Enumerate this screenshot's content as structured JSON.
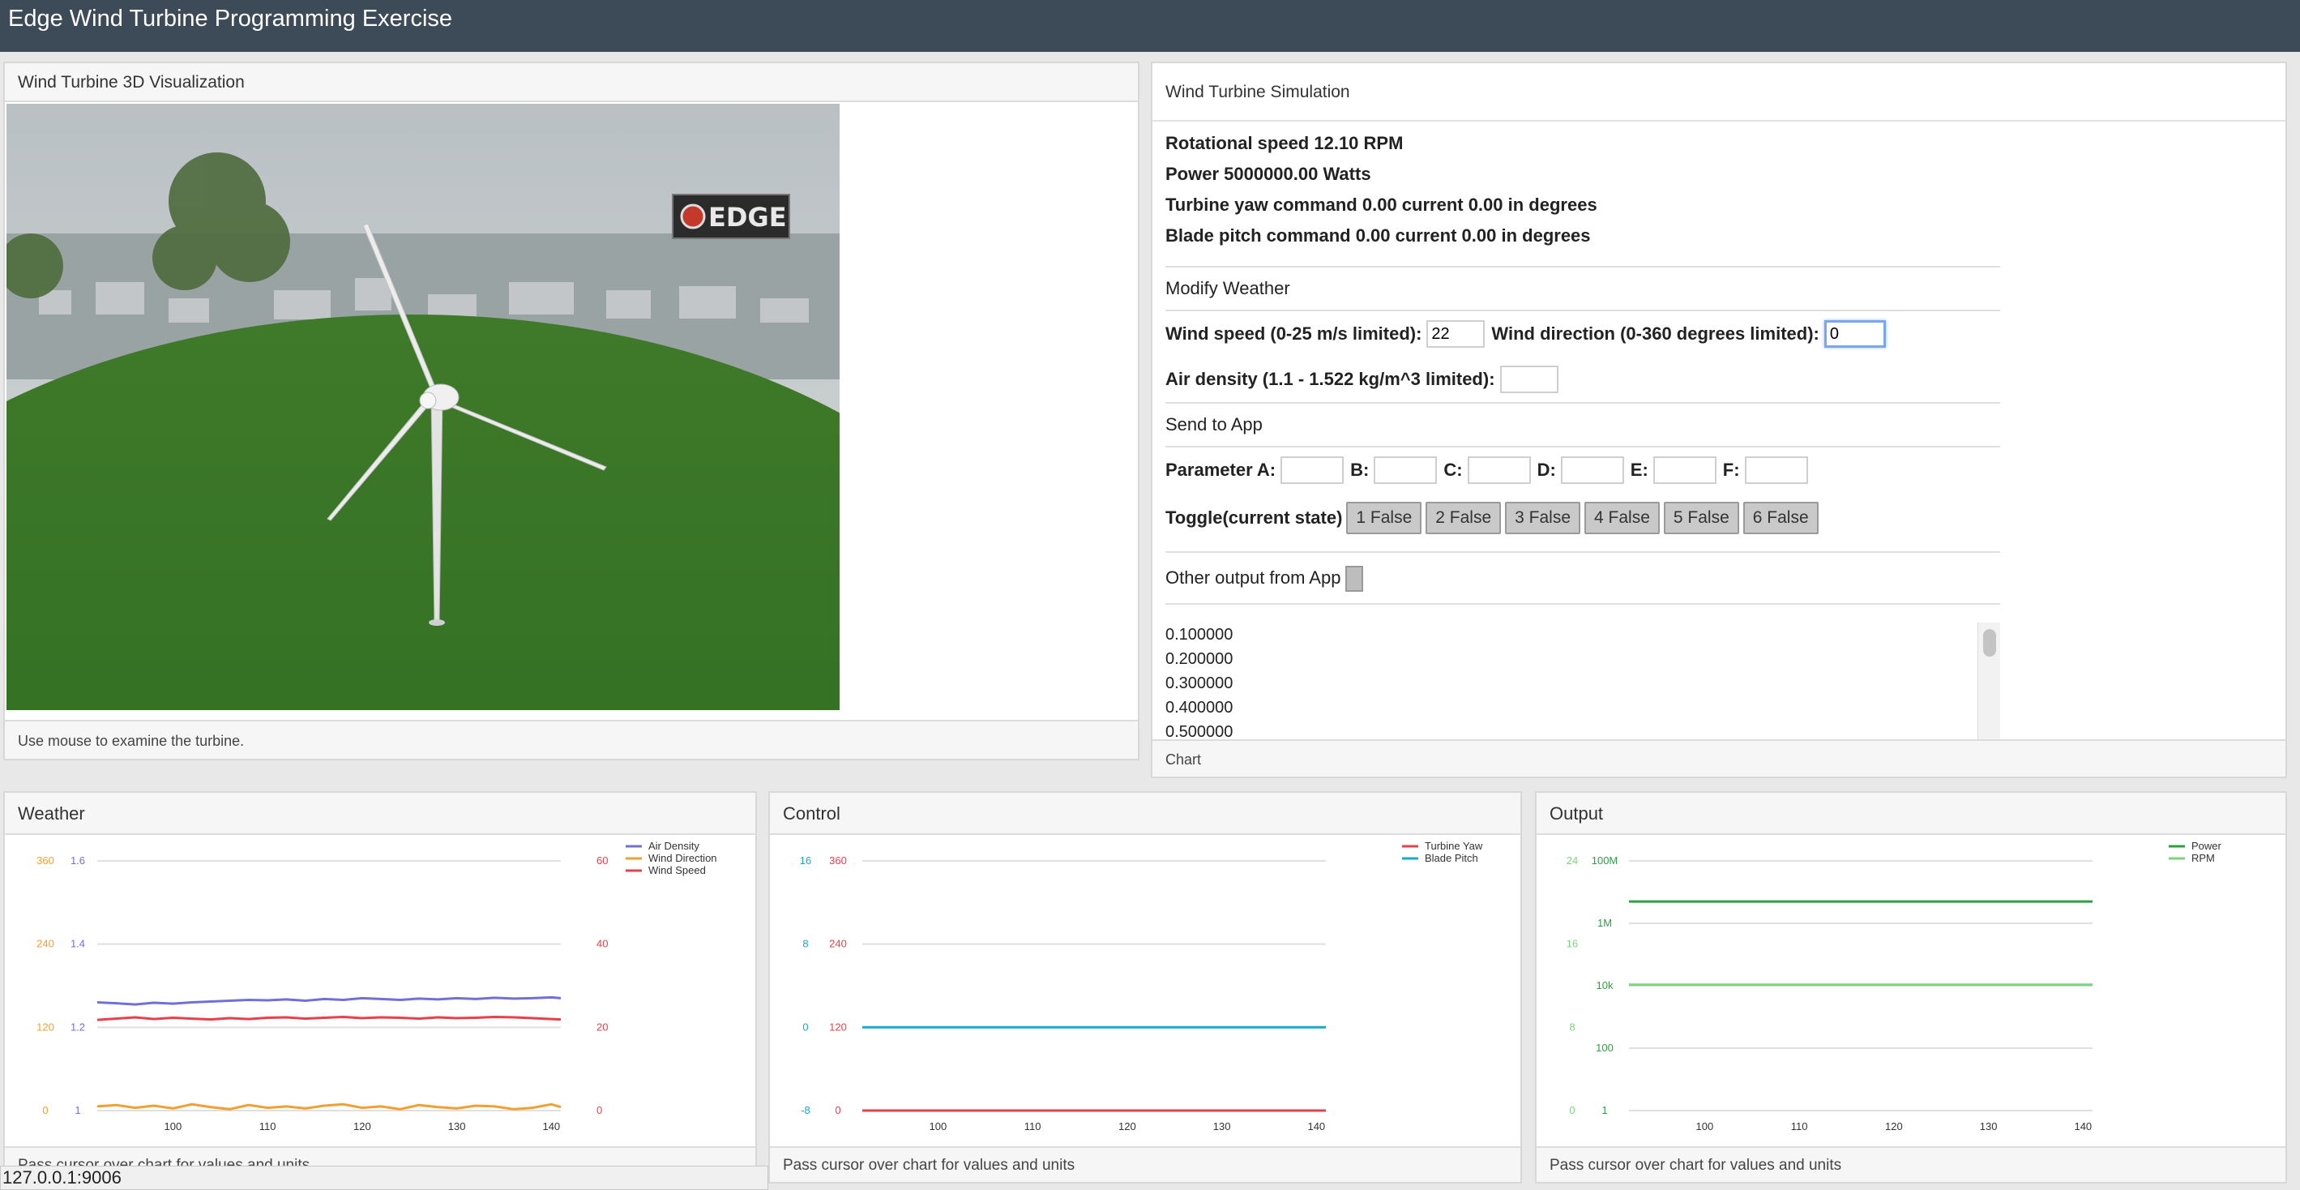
{
  "app": {
    "title": "Edge Wind Turbine Programming Exercise"
  },
  "viz": {
    "title": "Wind Turbine 3D Visualization",
    "footer": "Use mouse to examine the turbine.",
    "logo_text": "EDGE"
  },
  "sim": {
    "title": "Wind Turbine Simulation",
    "stats": [
      "Rotational speed 12.10 RPM",
      "Power 5000000.00 Watts",
      "Turbine yaw command 0.00 current 0.00 in degrees",
      "Blade pitch command 0.00 current 0.00 in degrees"
    ],
    "modify_weather": {
      "heading": "Modify Weather",
      "wind_speed_label": "Wind speed (0-25 m/s limited):",
      "wind_speed_value": "22",
      "wind_direction_label": "Wind direction (0-360 degrees limited):",
      "wind_direction_value": "0",
      "air_density_label": "Air density (1.1 - 1.522 kg/m^3 limited):",
      "air_density_value": ""
    },
    "send_to_app": {
      "heading": "Send to App",
      "param_a_label": "Parameter A:",
      "b_label": "B:",
      "c_label": "C:",
      "d_label": "D:",
      "e_label": "E:",
      "f_label": "F:",
      "toggle_label": "Toggle(current state)",
      "toggles": [
        "1 False",
        "2 False",
        "3 False",
        "4 False",
        "5 False",
        "6 False"
      ]
    },
    "other_output": {
      "heading": "Other output from App",
      "lines": [
        "0.100000",
        "0.200000",
        "0.300000",
        "0.400000",
        "0.500000"
      ]
    },
    "footer": "Chart"
  },
  "weather_panel": {
    "title": "Weather",
    "footer": "Pass cursor over chart for values and units"
  },
  "control_panel": {
    "title": "Control",
    "footer": "Pass cursor over chart for values and units"
  },
  "output_panel": {
    "title": "Output",
    "footer": "Pass cursor over chart for values and units"
  },
  "status_url": "127.0.0.1:9006",
  "colors": {
    "topbar": "#3d4a57",
    "air_density": "#7070d8",
    "wind_direction": "#f0a030",
    "wind_speed": "#e8404a",
    "turbine_yaw": "#e8404a",
    "blade_pitch": "#1aa8d0",
    "power": "#2ea043",
    "rpm": "#7ad67a"
  },
  "chart_data": [
    {
      "type": "line",
      "name": "weather",
      "x_ticks": [
        100,
        110,
        120,
        130,
        140
      ],
      "xlim": [
        92,
        141
      ],
      "axes": {
        "wind_direction": {
          "ticks": [
            "0",
            "120",
            "240",
            "360"
          ],
          "range": [
            0,
            360
          ],
          "color": "#f0a030"
        },
        "air_density": {
          "ticks": [
            "1",
            "1.2",
            "1.4",
            "1.6"
          ],
          "range": [
            1,
            1.6
          ],
          "color": "#7070d8"
        },
        "wind_speed": {
          "ticks": [
            "0",
            "20",
            "40",
            "60"
          ],
          "range": [
            0,
            60
          ],
          "color": "#e8404a"
        }
      },
      "legend": [
        "Air Density",
        "Wind Direction",
        "Wind Speed"
      ],
      "series": [
        {
          "name": "Air Density",
          "axis": "air_density",
          "color": "#7070d8",
          "x": [
            92,
            94,
            96,
            98,
            100,
            102,
            104,
            106,
            108,
            110,
            112,
            114,
            116,
            118,
            120,
            122,
            124,
            126,
            128,
            130,
            132,
            134,
            136,
            138,
            140,
            141
          ],
          "y": [
            1.26,
            1.258,
            1.255,
            1.259,
            1.257,
            1.26,
            1.262,
            1.264,
            1.266,
            1.265,
            1.267,
            1.264,
            1.268,
            1.266,
            1.27,
            1.268,
            1.266,
            1.269,
            1.267,
            1.27,
            1.268,
            1.271,
            1.269,
            1.27,
            1.272,
            1.27
          ]
        },
        {
          "name": "Wind Direction",
          "axis": "wind_direction",
          "color": "#f0a030",
          "x": [
            92,
            94,
            96,
            98,
            100,
            102,
            104,
            106,
            108,
            110,
            112,
            114,
            116,
            118,
            120,
            122,
            124,
            126,
            128,
            130,
            132,
            134,
            136,
            138,
            140,
            141
          ],
          "y": [
            6,
            8,
            4,
            7,
            3,
            9,
            5,
            2,
            8,
            4,
            6,
            3,
            7,
            9,
            4,
            6,
            2,
            8,
            5,
            3,
            7,
            6,
            2,
            4,
            9,
            5
          ]
        },
        {
          "name": "Wind Speed",
          "axis": "wind_speed",
          "color": "#e8404a",
          "x": [
            92,
            94,
            96,
            98,
            100,
            102,
            104,
            106,
            108,
            110,
            112,
            114,
            116,
            118,
            120,
            122,
            124,
            126,
            128,
            130,
            132,
            134,
            136,
            138,
            140,
            141
          ],
          "y": [
            21.8,
            22.1,
            22.4,
            22.0,
            22.3,
            22.1,
            21.9,
            22.2,
            22.0,
            22.3,
            22.4,
            22.1,
            22.3,
            22.5,
            22.2,
            22.4,
            22.3,
            22.1,
            22.4,
            22.2,
            22.3,
            22.5,
            22.4,
            22.2,
            22.0,
            21.9
          ]
        }
      ]
    },
    {
      "type": "line",
      "name": "control",
      "x_ticks": [
        100,
        110,
        120,
        130,
        140
      ],
      "xlim": [
        92,
        141
      ],
      "axes": {
        "blade_pitch": {
          "ticks": [
            "-8",
            "0",
            "8",
            "16"
          ],
          "range": [
            -8,
            16
          ],
          "color": "#1aa8d0"
        },
        "turbine_yaw": {
          "ticks": [
            "0",
            "120",
            "240",
            "360"
          ],
          "range": [
            0,
            360
          ],
          "color": "#e8404a"
        }
      },
      "legend": [
        "Turbine Yaw",
        "Blade Pitch"
      ],
      "series": [
        {
          "name": "Turbine Yaw",
          "axis": "turbine_yaw",
          "color": "#e8404a",
          "x": [
            92,
            141
          ],
          "y": [
            0,
            0
          ]
        },
        {
          "name": "Blade Pitch",
          "axis": "blade_pitch",
          "color": "#1aa8d0",
          "x": [
            92,
            141
          ],
          "y": [
            0,
            0
          ]
        }
      ]
    },
    {
      "type": "line",
      "name": "output",
      "x_ticks": [
        100,
        110,
        120,
        130,
        140
      ],
      "xlim": [
        92,
        141
      ],
      "axes": {
        "rpm": {
          "ticks": [
            "0",
            "8",
            "16",
            "24"
          ],
          "range": [
            0,
            24
          ],
          "color": "#7ad67a"
        },
        "power": {
          "ticks": [
            "1",
            "100",
            "10k",
            "1M",
            "100M"
          ],
          "log_range": [
            0,
            8
          ],
          "color": "#2ea043",
          "scale": "log"
        }
      },
      "legend": [
        "Power",
        "RPM"
      ],
      "series": [
        {
          "name": "Power",
          "axis": "power",
          "color": "#2ea043",
          "x": [
            92,
            141
          ],
          "y": [
            5000000,
            5000000
          ]
        },
        {
          "name": "RPM",
          "axis": "rpm",
          "color": "#7ad67a",
          "x": [
            92,
            141
          ],
          "y": [
            12.1,
            12.1
          ]
        }
      ]
    }
  ]
}
